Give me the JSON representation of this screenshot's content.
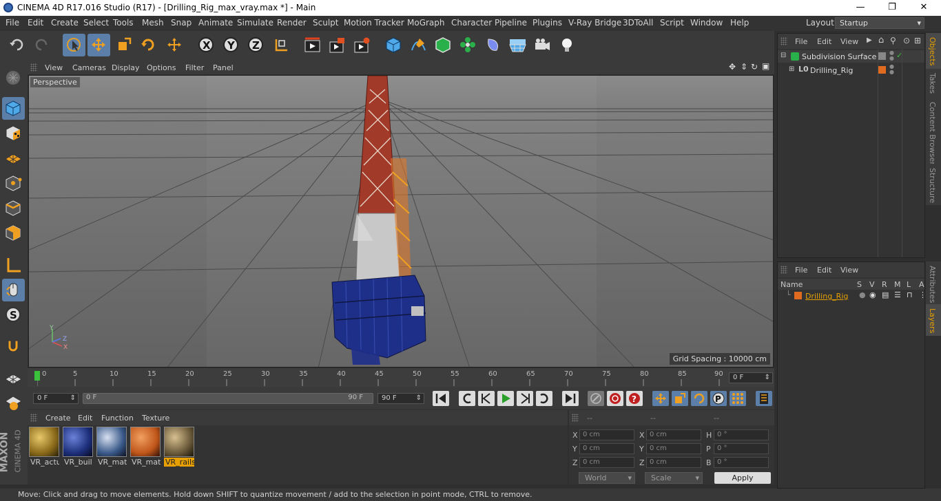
{
  "window": {
    "title": "CINEMA 4D R17.016 Studio (R17) - [Drilling_Rig_max_vray.max *] - Main",
    "min": "—",
    "max": "❐",
    "close": "✕"
  },
  "menu": {
    "items": [
      "File",
      "Edit",
      "Create",
      "Select",
      "Tools",
      "Mesh",
      "Snap",
      "Animate",
      "Simulate",
      "Render",
      "Sculpt",
      "Motion Tracker",
      "MoGraph",
      "Character",
      "Pipeline",
      "Plugins",
      "V-Ray Bridge",
      "3DToAll",
      "Script",
      "Window",
      "Help"
    ],
    "layout_label": "Layout:",
    "layout_value": "Startup"
  },
  "viewport": {
    "menu": [
      "View",
      "Cameras",
      "Display",
      "Options",
      "Filter",
      "Panel"
    ],
    "label": "Perspective",
    "grid_spacing": "Grid Spacing : 10000 cm",
    "axis_y": "Y",
    "axis_z": "Z",
    "axis_x": "X"
  },
  "timeline": {
    "ticks": [
      "0",
      "5",
      "10",
      "15",
      "20",
      "25",
      "30",
      "35",
      "40",
      "45",
      "50",
      "55",
      "60",
      "65",
      "70",
      "75",
      "80",
      "85",
      "90"
    ],
    "current": "0 F",
    "start": "0 F",
    "range_start": "0 F",
    "range_end": "90 F",
    "end": "90 F"
  },
  "materials": {
    "menu": [
      "Create",
      "Edit",
      "Function",
      "Texture"
    ],
    "items": [
      {
        "label": "VR_actu",
        "color": "#b08a2a"
      },
      {
        "label": "VR_buil",
        "color": "#1d2f7a"
      },
      {
        "label": "VR_mat_",
        "color": "#3a5a8a"
      },
      {
        "label": "VR_mat_",
        "color": "#c0561a"
      },
      {
        "label": "VR_rails",
        "color": "#6a5a3a"
      }
    ]
  },
  "coords": {
    "head1": "--",
    "head2": "--",
    "head3": "--",
    "labels": [
      "X",
      "Y",
      "Z",
      "X",
      "Y",
      "Z",
      "H",
      "P",
      "B"
    ],
    "pos": [
      "0 cm",
      "0 cm",
      "0 cm"
    ],
    "size": [
      "0 cm",
      "0 cm",
      "0 cm"
    ],
    "rot": [
      "0 °",
      "0 °",
      "0 °"
    ],
    "world": "World",
    "scale": "Scale",
    "apply": "Apply"
  },
  "objects": {
    "menu": [
      "File",
      "Edit",
      "View"
    ],
    "items": [
      {
        "name": "Subdivision Surface"
      },
      {
        "name": "Drilling_Rig"
      }
    ]
  },
  "layers": {
    "menu": [
      "File",
      "Edit",
      "View"
    ],
    "header_name": "Name",
    "cols": [
      "S",
      "V",
      "R",
      "M",
      "L",
      "A"
    ],
    "row": "Drilling_Rig"
  },
  "tabs": {
    "objects": "Objects",
    "takes": "Takes",
    "content": "Content Browser",
    "structure": "Structure",
    "attributes": "Attributes",
    "layers": "Layers"
  },
  "status": "Move: Click and drag to move elements. Hold down SHIFT to quantize movement / add to the selection in point mode, CTRL to remove.",
  "brand": {
    "maxon": "MAXON",
    "c4d": "CINEMA 4D"
  }
}
